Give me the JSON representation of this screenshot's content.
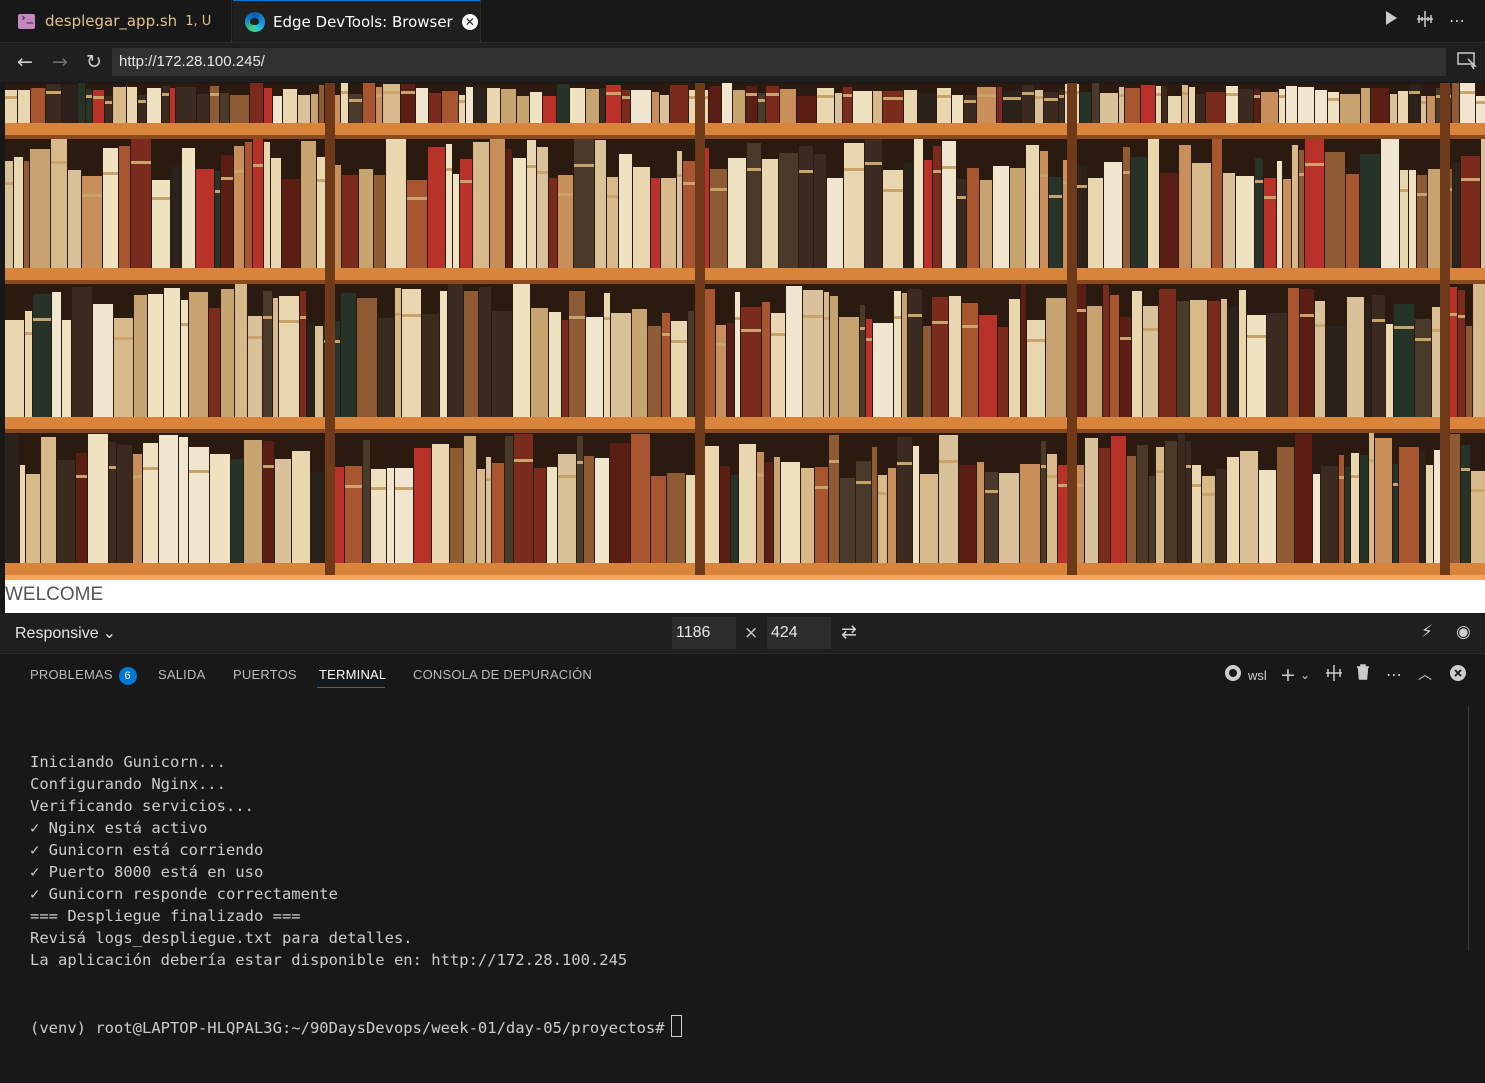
{
  "tabs": [
    {
      "label": "desplegar_app.sh",
      "modifier": "1, U",
      "icon": "terminal-file-icon"
    },
    {
      "label": "Edge DevTools: Browser",
      "icon": "edge-icon",
      "active": true
    }
  ],
  "address": {
    "url": "http://172.28.100.245/"
  },
  "page": {
    "welcome_text": "WELCOME"
  },
  "device_toolbar": {
    "mode": "Responsive",
    "width": "1186",
    "height": "424",
    "times": "×"
  },
  "panel": {
    "tabs": [
      {
        "label": "PROBLEMAS",
        "badge": "6"
      },
      {
        "label": "SALIDA"
      },
      {
        "label": "PUERTOS"
      },
      {
        "label": "TERMINAL",
        "active": true
      },
      {
        "label": "CONSOLA DE DEPURACIÓN"
      }
    ],
    "terminal_profile": "wsl",
    "terminal_lines": [
      "Iniciando Gunicorn...",
      "Configurando Nginx...",
      "Verificando servicios...",
      "✓ Nginx está activo",
      "✓ Gunicorn está corriendo",
      "✓ Puerto 8000 está en uso",
      "✓ Gunicorn responde correctamente",
      "=== Despliegue finalizado ===",
      "Revisá logs_despliegue.txt para detalles.",
      "La aplicación debería estar disponible en: http://172.28.100.245"
    ],
    "prompt": "(venv) root@LAPTOP-HLQPAL3G:~/90DaysDevops/week-01/day-05/proyectos#"
  },
  "colors": {
    "accent": "#0078d4",
    "modified": "#e2c08d",
    "shelf_wood": "#d9843b"
  }
}
